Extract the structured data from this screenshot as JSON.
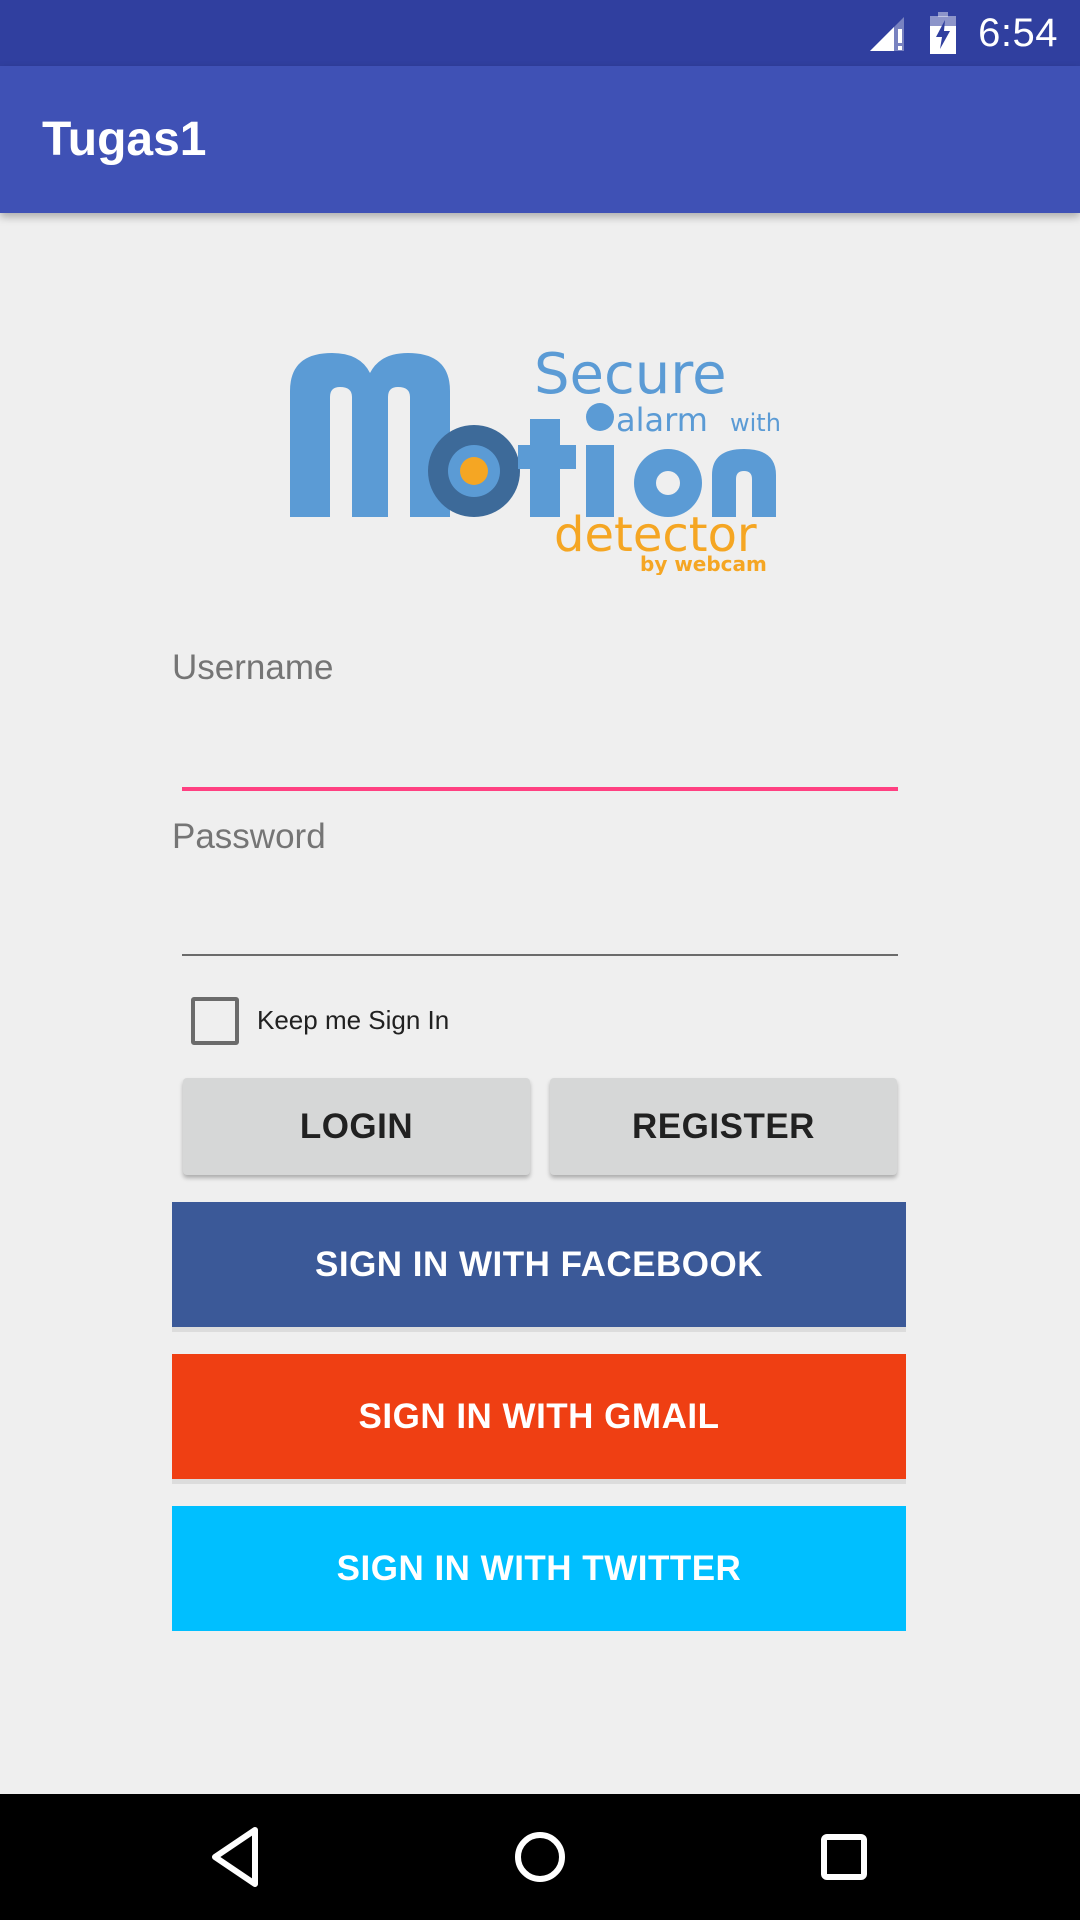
{
  "status_bar": {
    "time": "6:54",
    "icons": [
      "signal-icon",
      "battery-charging-icon"
    ]
  },
  "app_bar": {
    "title": "Tugas1"
  },
  "logo": {
    "secure": "Secure",
    "alarm_with": "alarm",
    "with": "with",
    "motion": "Motion",
    "detector": "detector",
    "by_webcam": "by webcam"
  },
  "form": {
    "username_label": "Username",
    "username_value": "",
    "password_label": "Password",
    "password_value": "",
    "keep_signed_in_label": "Keep me Sign In",
    "keep_signed_in_checked": false
  },
  "buttons": {
    "login": "LOGIN",
    "register": "REGISTER",
    "facebook": "SIGN IN WITH FACEBOOK",
    "gmail": "SIGN IN WITH GMAIL",
    "twitter": "SIGN IN WITH TWITTER"
  },
  "nav_bar": {
    "icons": [
      "back-icon",
      "home-icon",
      "recents-icon"
    ]
  },
  "colors": {
    "status_bar": "#303f9f",
    "app_bar": "#3f51b5",
    "accent": "#ff4081",
    "facebook": "#3b5998",
    "gmail": "#ef3f13",
    "twitter": "#00bfff",
    "logo_blue": "#5b9bd5",
    "logo_orange": "#f5a623"
  }
}
